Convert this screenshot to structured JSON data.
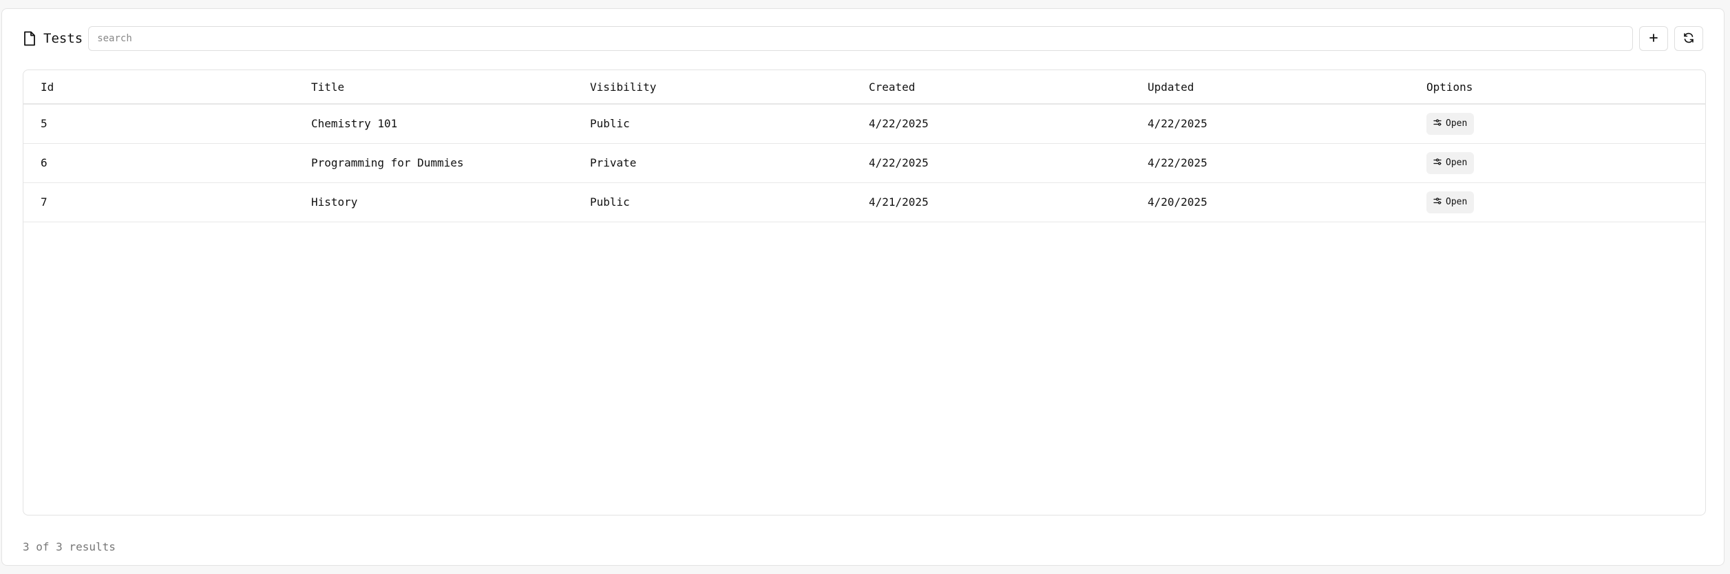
{
  "header": {
    "title": "Tests",
    "title_icon": "file-icon",
    "search": {
      "placeholder": "search",
      "value": ""
    },
    "buttons": [
      {
        "name": "add-button",
        "icon": "plus-icon",
        "label": "+"
      },
      {
        "name": "refresh-button",
        "icon": "refresh-icon"
      }
    ]
  },
  "table": {
    "columns": [
      "Id",
      "Title",
      "Visibility",
      "Created",
      "Updated",
      "Options"
    ],
    "rows": [
      {
        "id": "5",
        "title": "Chemistry 101",
        "visibility": "Public",
        "created": "4/22/2025",
        "updated": "4/22/2025",
        "action": "Open"
      },
      {
        "id": "6",
        "title": "Programming for Dummies",
        "visibility": "Private",
        "created": "4/22/2025",
        "updated": "4/22/2025",
        "action": "Open"
      },
      {
        "id": "7",
        "title": "History",
        "visibility": "Public",
        "created": "4/21/2025",
        "updated": "4/20/2025",
        "action": "Open"
      }
    ],
    "action_icon": "sliders-icon"
  },
  "footer": {
    "results": "3 of 3 results"
  }
}
